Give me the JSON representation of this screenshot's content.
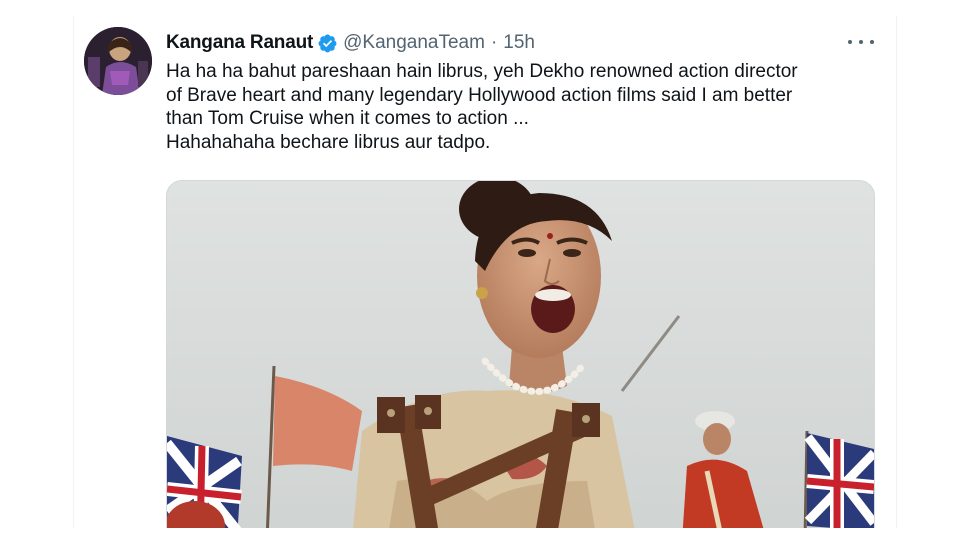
{
  "tweet": {
    "display_name": "Kangana Ranaut",
    "verified": true,
    "handle": "@KanganaTeam",
    "separator": "·",
    "time": "15h",
    "more_icon": "more-horizontal-icon",
    "text_lines": [
      "Ha ha ha bahut pareshaan hain librus, yeh Dekho renowned action director",
      "of Brave heart and many legendary Hollywood action films said I am better",
      "than Tom Cruise when it comes to action ...",
      "Hahahahaha bechare librus aur tadpo."
    ]
  },
  "colors": {
    "text_primary": "#0f1419",
    "text_secondary": "#536471",
    "verified_blue": "#1d9bf0",
    "border": "#cfd9de"
  },
  "icons": {
    "verified": "verified-badge-icon",
    "more": "more-horizontal-icon"
  }
}
